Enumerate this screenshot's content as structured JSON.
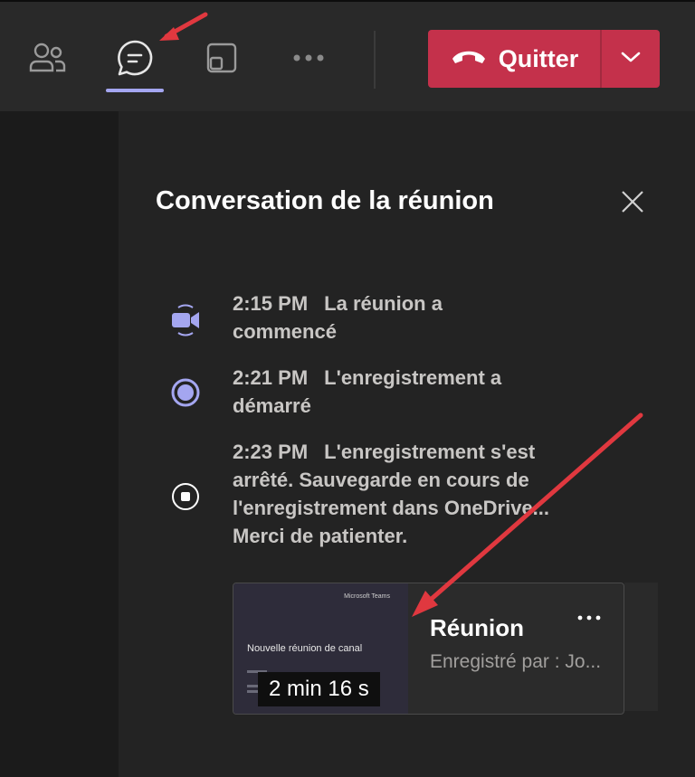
{
  "toolbar": {
    "icons": [
      "people-icon",
      "chat-icon",
      "share-screen-icon",
      "more-options-icon"
    ],
    "active_icon": "chat-icon",
    "quit_label": "Quitter",
    "quit_icon": "hang-up-phone-icon",
    "quit_color": "#c4314b"
  },
  "panel": {
    "title": "Conversation de la réunion",
    "close_icon": "close-icon",
    "events": [
      {
        "time": "2:15 PM",
        "text": "La réunion a commencé",
        "icon": "video-camera-icon"
      },
      {
        "time": "2:21 PM",
        "text": "L'enregistrement a démarré",
        "icon": "record-icon"
      },
      {
        "time": "2:23 PM",
        "text": "L'enregistrement s'est arrêté. Sauvegarde en cours de l'enregistrement dans OneDrive... Merci de patienter.",
        "icon": "stop-icon"
      }
    ],
    "recording_card": {
      "thumbnail_logo": "Microsoft Teams",
      "thumbnail_title": "Nouvelle réunion de canal",
      "duration": "2 min 16 s",
      "title": "Réunion",
      "subtitle": "Enregistré par : Jo..."
    }
  },
  "colors": {
    "accent": "#a4a6f0",
    "annotation_arrow": "#e0383f"
  }
}
